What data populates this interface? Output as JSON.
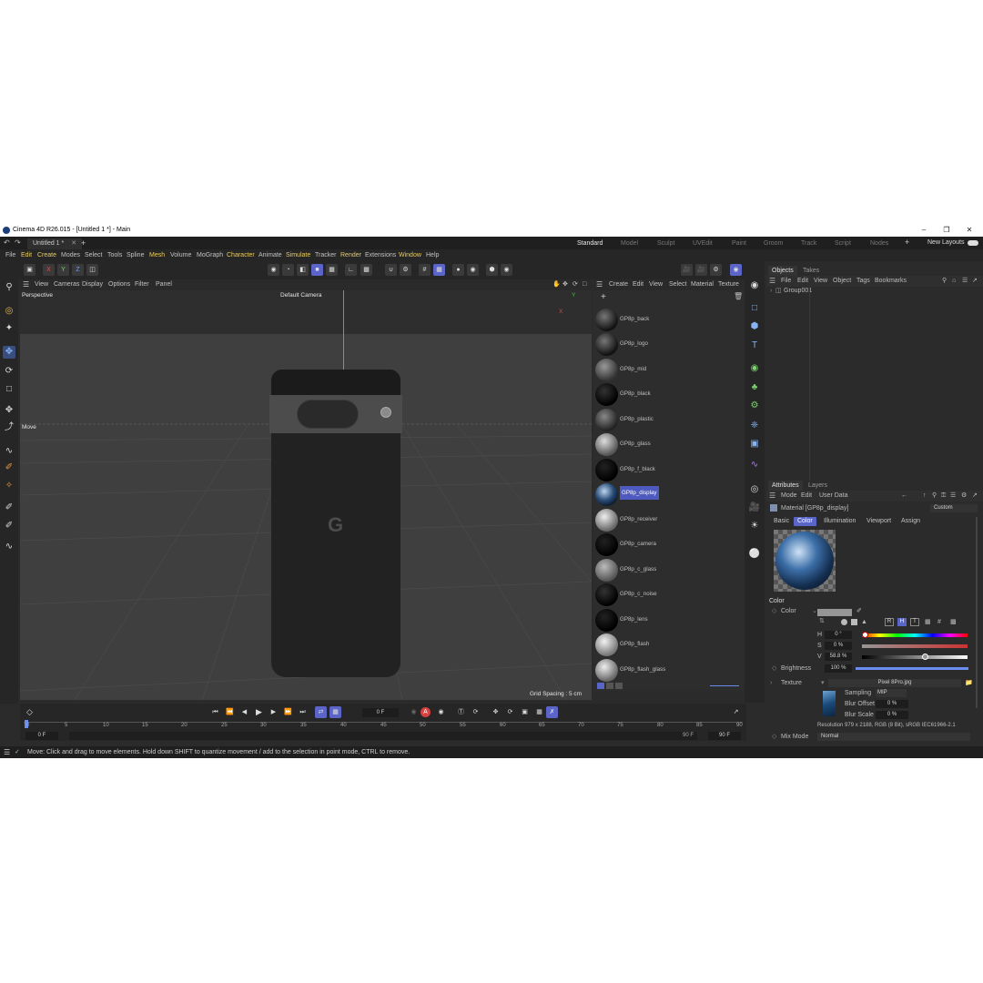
{
  "window": {
    "title": "Cinema 4D R26.015 - [Untitled 1 *] - Main",
    "minimize_icon": "minimize-icon",
    "maximize_icon": "maximize-icon",
    "close_icon": "close-icon"
  },
  "tabs": {
    "doc_tab": "Untitled 1 *",
    "add_tab": "+",
    "layouts": [
      "Standard",
      "Model",
      "Sculpt",
      "UVEdit",
      "Paint",
      "Groom",
      "Track",
      "Script",
      "Nodes"
    ],
    "active_layout": "Standard",
    "new_layouts": "New Layouts"
  },
  "menu": {
    "items": [
      "File",
      "Edit",
      "Create",
      "Modes",
      "Select",
      "Tools",
      "Spline",
      "Mesh",
      "Volume",
      "MoGraph",
      "Character",
      "Animate",
      "Simulate",
      "Tracker",
      "Render",
      "Extensions",
      "Window",
      "Help"
    ],
    "highlight": [
      "Edit",
      "Create",
      "Mesh",
      "Character",
      "Simulate",
      "Render",
      "Window"
    ]
  },
  "toolbar": {
    "axis_labels": [
      "X",
      "Y",
      "Z"
    ]
  },
  "viewport": {
    "menu": [
      "View",
      "Cameras",
      "Display",
      "Options",
      "Filter",
      "Panel"
    ],
    "label": "Perspective",
    "camera": "Default Camera",
    "tool_label": "Move",
    "grid_spacing": "Grid Spacing : 5 cm",
    "axis_x": "X",
    "axis_y": "Y",
    "logo": "G"
  },
  "materials": {
    "menu": [
      "Create",
      "Edit",
      "View",
      "Select",
      "Material",
      "Texture"
    ],
    "items": [
      "GP8p_back",
      "GP8p_logo",
      "GP8p_mid",
      "GP8p_black",
      "GP8p_plastic",
      "GP8p_glass",
      "GP8p_f_black",
      "GP8p_display",
      "GP8p_receiver",
      "GP8p_camera",
      "GP8p_c_glass",
      "GP8p_c_noise",
      "GP8p_lens",
      "GP8p_flash",
      "GP8p_flash_glass"
    ],
    "selected": "GP8p_display"
  },
  "objects": {
    "tabs": [
      "Objects",
      "Takes"
    ],
    "menu": [
      "File",
      "Edit",
      "View",
      "Object",
      "Tags",
      "Bookmarks"
    ],
    "tree": [
      "Group001"
    ]
  },
  "attributes": {
    "tabs": [
      "Attributes",
      "Layers"
    ],
    "menu": [
      "Mode",
      "Edit",
      "User Data"
    ],
    "preset": "Custom",
    "material_label": "Material [GP8p_display]",
    "subtabs": [
      "Basic",
      "Color",
      "Illumination",
      "Viewport",
      "Assign"
    ],
    "active_subtab": "Color",
    "section": "Color",
    "color_label": "Color",
    "mode_buttons": [
      "R",
      "H",
      "T"
    ],
    "h_label": "H",
    "h_value": "0 °",
    "s_label": "S",
    "s_value": "0 %",
    "v_label": "V",
    "v_value": "58.8 %",
    "brightness_label": "Brightness",
    "brightness_value": "100 %",
    "texture_label": "Texture",
    "texture_file": "Pixel 8Pro.jpg",
    "sampling_label": "Sampling",
    "sampling_value": "MIP",
    "blur_offset_label": "Blur Offset",
    "blur_offset_value": "0 %",
    "blur_scale_label": "Blur Scale",
    "blur_scale_value": "0 %",
    "resolution": "Resolution 979 x 2188, RGB (8 Bit), sRGB IEC61966-2.1",
    "mix_mode_label": "Mix Mode",
    "mix_mode_value": "Normal"
  },
  "timeline": {
    "current_frame": "0 F",
    "ticks": [
      "0",
      "5",
      "10",
      "15",
      "20",
      "25",
      "30",
      "35",
      "40",
      "45",
      "50",
      "55",
      "60",
      "65",
      "70",
      "75",
      "80",
      "85",
      "90"
    ],
    "start": "0 F",
    "start2": "0 F",
    "end": "90 F",
    "end2": "90 F",
    "record_label": "A"
  },
  "status": {
    "message": "Move: Click and drag to move elements. Hold down SHIFT to quantize movement / add to the selection in point mode, CTRL to remove."
  },
  "colors": {
    "accent": "#5b65c9",
    "menu_highlight": "#e9cd61",
    "background": "#2b2b2b"
  }
}
